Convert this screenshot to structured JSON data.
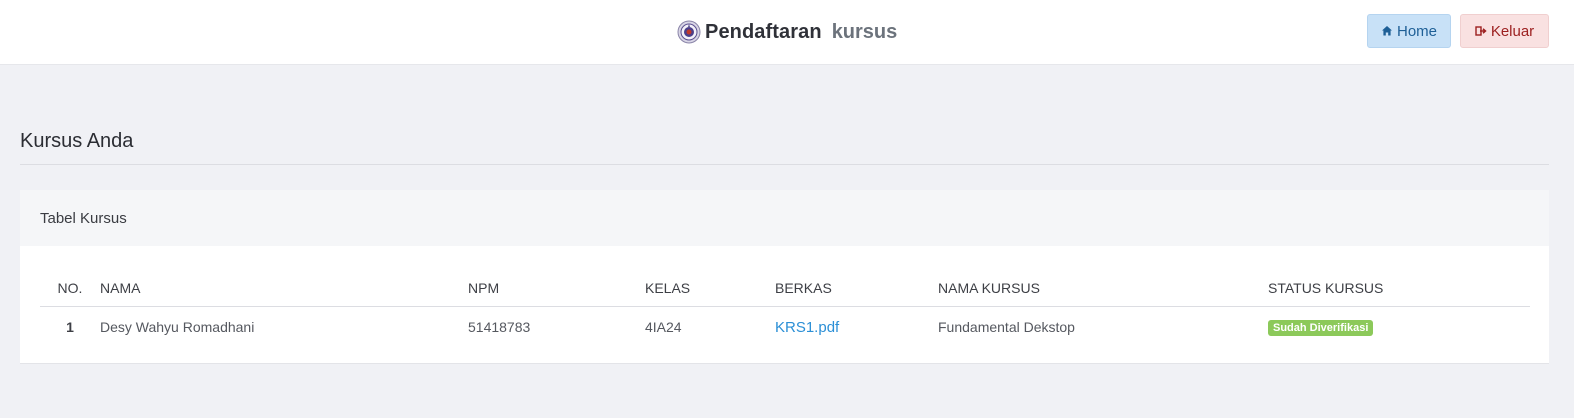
{
  "header": {
    "brand_title": "Pendaftaran",
    "brand_subtitle": "kursus",
    "home_label": "Home",
    "logout_label": "Keluar"
  },
  "section": {
    "title": "Kursus Anda"
  },
  "card": {
    "title": "Tabel Kursus"
  },
  "table": {
    "headers": {
      "no": "NO.",
      "nama": "NAMA",
      "npm": "NPM",
      "kelas": "KELAS",
      "berkas": "BERKAS",
      "nama_kursus": "NAMA KURSUS",
      "status": "STATUS KURSUS"
    },
    "rows": [
      {
        "no": "1",
        "nama": "Desy Wahyu Romadhani",
        "npm": "51418783",
        "kelas": "4IA24",
        "berkas": "KRS1.pdf",
        "nama_kursus": "Fundamental Dekstop",
        "status": "Sudah Diverifikasi"
      }
    ]
  },
  "colors": {
    "home_button_bg": "#c8e1f7",
    "logout_button_bg": "#f9e1e1",
    "status_badge_bg": "#8cc95a",
    "link": "#2b8fd6"
  },
  "icons": {
    "logo": "university-seal-icon",
    "home": "home-icon",
    "logout": "sign-out-icon"
  }
}
